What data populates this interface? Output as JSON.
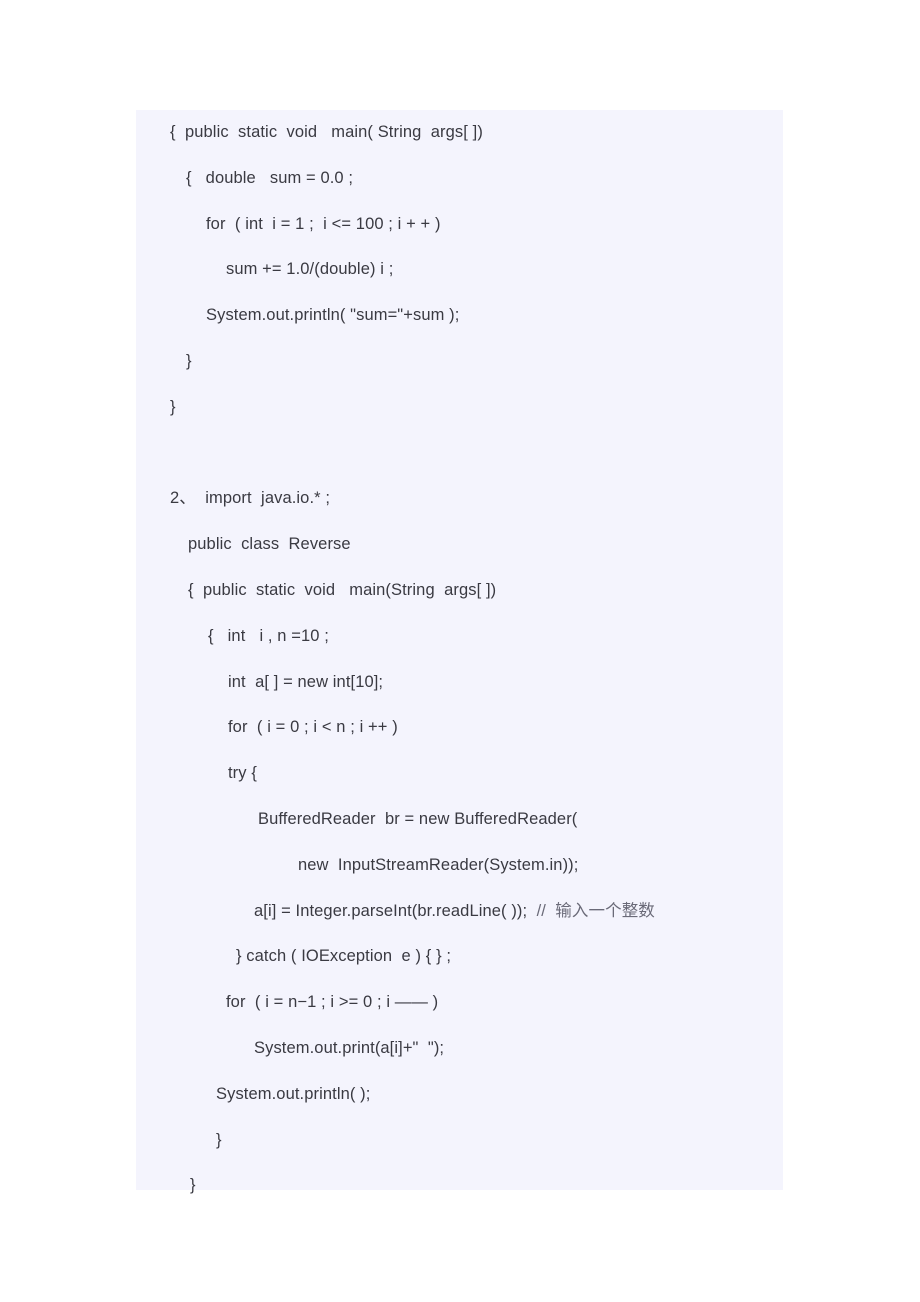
{
  "document": {
    "type": "code-listing",
    "background_color": "#ffffff",
    "code_block_background": "#f4f4fd",
    "text_color": "#3a3a42",
    "comment_color": "#6a6a78",
    "lines": [
      {
        "indent": 34,
        "text": "{  public  static  void   main( String  args[ ])"
      },
      {
        "indent": 50,
        "text": "{   double   sum = 0.0 ;"
      },
      {
        "indent": 70,
        "text": "for  ( int  i = 1 ;  i <= 100 ; i + + )"
      },
      {
        "indent": 90,
        "text": "sum += 1.0/(double) i ;"
      },
      {
        "indent": 70,
        "text": "System.out.println( \"sum=\"+sum );"
      },
      {
        "indent": 50,
        "text": "}"
      },
      {
        "indent": 34,
        "text": "}"
      },
      {
        "indent": 0,
        "text": ""
      },
      {
        "indent": 34,
        "text": "2、  import  java.io.* ;"
      },
      {
        "indent": 52,
        "text": "public  class  Reverse"
      },
      {
        "indent": 52,
        "text": "{  public  static  void   main(String  args[ ])"
      },
      {
        "indent": 72,
        "text": "{   int   i , n =10 ;"
      },
      {
        "indent": 92,
        "text": "int  a[ ] = new int[10];"
      },
      {
        "indent": 92,
        "text": "for  ( i = 0 ; i < n ; i ++ )"
      },
      {
        "indent": 92,
        "text": "try {"
      },
      {
        "indent": 122,
        "text": "BufferedReader  br = new BufferedReader("
      },
      {
        "indent": 162,
        "text": "new  InputStreamReader(System.in));"
      },
      {
        "indent": 118,
        "text": "a[i] = Integer.parseInt(br.readLine( ));  ",
        "comment": "//  输入一个整数"
      },
      {
        "indent": 100,
        "text": "} catch ( IOException  e ) { } ;"
      },
      {
        "indent": 90,
        "text": "for  ( i = n−1 ; i >= 0 ; i —— )"
      },
      {
        "indent": 118,
        "text": "System.out.print(a[i]+\"  \");"
      },
      {
        "indent": 80,
        "text": "System.out.println( );"
      },
      {
        "indent": 80,
        "text": "}"
      },
      {
        "indent": 54,
        "text": "}"
      }
    ]
  }
}
